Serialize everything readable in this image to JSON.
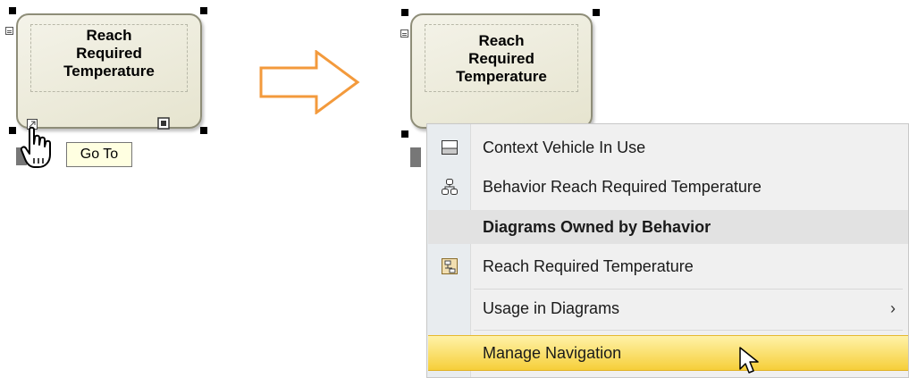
{
  "left_panel": {
    "action_label": "Reach\nRequired\nTemperature",
    "tooltip": "Go To"
  },
  "right_panel": {
    "action_label": "Reach\nRequired\nTemperature"
  },
  "arrow": {
    "color": "#f39a3c"
  },
  "context_menu": {
    "items": [
      {
        "label": "Context Vehicle In Use",
        "icon": "diagram-frame-icon"
      },
      {
        "label": "Behavior Reach Required Temperature",
        "icon": "behavior-icon"
      },
      {
        "label": "Diagrams Owned by Behavior",
        "icon": ""
      },
      {
        "label": "Reach Required Temperature",
        "icon": "activity-diagram-icon"
      },
      {
        "label": "Usage in Diagrams",
        "submenu_glyph": "›"
      },
      {
        "label": "Manage Navigation"
      }
    ],
    "highlight_color": "#f6cf3a"
  }
}
